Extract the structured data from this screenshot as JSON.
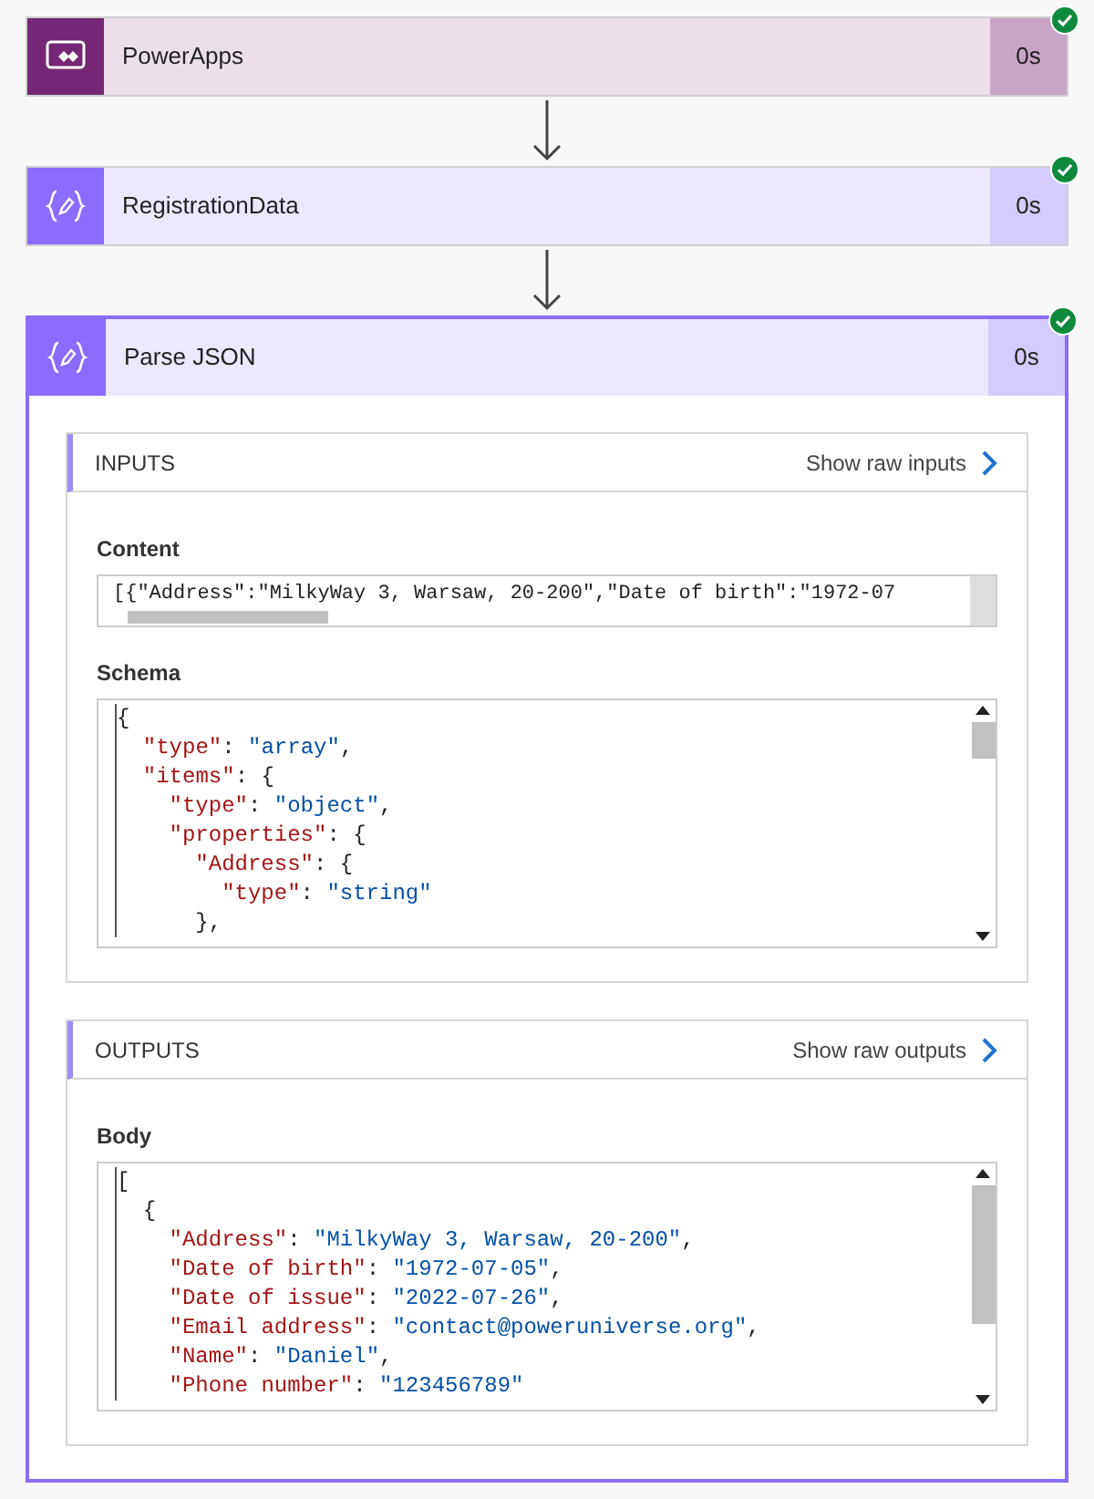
{
  "steps": [
    {
      "kind": "powerapps",
      "title": "PowerApps",
      "duration": "0s",
      "succeeded": true,
      "expanded": false
    },
    {
      "kind": "variable",
      "title": "RegistrationData",
      "duration": "0s",
      "succeeded": true,
      "expanded": false
    },
    {
      "kind": "variable",
      "title": "Parse JSON",
      "duration": "0s",
      "succeeded": true,
      "expanded": true,
      "sections": [
        {
          "title": "INPUTS",
          "link": "Show raw inputs",
          "fields": [
            {
              "kind": "line",
              "label": "Content",
              "value": "[{\"Address\":\"MilkyWay 3, Warsaw, 20-200\",\"Date of birth\":\"1972-07"
            },
            {
              "kind": "code",
              "label": "Schema",
              "lines": [
                {
                  "tokens": [
                    {
                      "kind": "punct",
                      "text": "{"
                    }
                  ],
                  "children": [
                    {
                      "tokens": [
                        {
                          "kind": "key",
                          "text": "\"type\""
                        },
                        {
                          "kind": "punct",
                          "text": ": "
                        },
                        {
                          "kind": "string",
                          "text": "\"array\""
                        },
                        {
                          "kind": "punct",
                          "text": ","
                        }
                      ]
                    },
                    {
                      "tokens": [
                        {
                          "kind": "key",
                          "text": "\"items\""
                        },
                        {
                          "kind": "punct",
                          "text": ": {"
                        }
                      ],
                      "children": [
                        {
                          "tokens": [
                            {
                              "kind": "key",
                              "text": "\"type\""
                            },
                            {
                              "kind": "punct",
                              "text": ": "
                            },
                            {
                              "kind": "string",
                              "text": "\"object\""
                            },
                            {
                              "kind": "punct",
                              "text": ","
                            }
                          ]
                        },
                        {
                          "tokens": [
                            {
                              "kind": "key",
                              "text": "\"properties\""
                            },
                            {
                              "kind": "punct",
                              "text": ": {"
                            }
                          ],
                          "children": [
                            {
                              "tokens": [
                                {
                                  "kind": "key",
                                  "text": "\"Address\""
                                },
                                {
                                  "kind": "punct",
                                  "text": ": {"
                                }
                              ],
                              "children": [
                                {
                                  "tokens": [
                                    {
                                      "kind": "key",
                                      "text": "\"type\""
                                    },
                                    {
                                      "kind": "punct",
                                      "text": ": "
                                    },
                                    {
                                      "kind": "string",
                                      "text": "\"string\""
                                    }
                                  ]
                                }
                              ]
                            },
                            {
                              "tokens": [
                                {
                                  "kind": "punct",
                                  "text": "},"
                                }
                              ]
                            }
                          ]
                        }
                      ]
                    }
                  ]
                }
              ]
            }
          ]
        },
        {
          "title": "OUTPUTS",
          "link": "Show raw outputs",
          "fields": [
            {
              "kind": "code",
              "label": "Body",
              "lines": [
                {
                  "tokens": [
                    {
                      "kind": "punct",
                      "text": "["
                    }
                  ],
                  "children": [
                    {
                      "tokens": [
                        {
                          "kind": "punct",
                          "text": "{"
                        }
                      ],
                      "children": [
                        {
                          "tokens": [
                            {
                              "kind": "key",
                              "text": "\"Address\""
                            },
                            {
                              "kind": "punct",
                              "text": ": "
                            },
                            {
                              "kind": "string",
                              "text": "\"MilkyWay 3, Warsaw, 20-200\""
                            },
                            {
                              "kind": "punct",
                              "text": ","
                            }
                          ]
                        },
                        {
                          "tokens": [
                            {
                              "kind": "key",
                              "text": "\"Date of birth\""
                            },
                            {
                              "kind": "punct",
                              "text": ": "
                            },
                            {
                              "kind": "string",
                              "text": "\"1972-07-05\""
                            },
                            {
                              "kind": "punct",
                              "text": ","
                            }
                          ]
                        },
                        {
                          "tokens": [
                            {
                              "kind": "key",
                              "text": "\"Date of issue\""
                            },
                            {
                              "kind": "punct",
                              "text": ": "
                            },
                            {
                              "kind": "string",
                              "text": "\"2022-07-26\""
                            },
                            {
                              "kind": "punct",
                              "text": ","
                            }
                          ]
                        },
                        {
                          "tokens": [
                            {
                              "kind": "key",
                              "text": "\"Email address\""
                            },
                            {
                              "kind": "punct",
                              "text": ": "
                            },
                            {
                              "kind": "string",
                              "text": "\"contact@poweruniverse.org\""
                            },
                            {
                              "kind": "punct",
                              "text": ","
                            }
                          ]
                        },
                        {
                          "tokens": [
                            {
                              "kind": "key",
                              "text": "\"Name\""
                            },
                            {
                              "kind": "punct",
                              "text": ": "
                            },
                            {
                              "kind": "string",
                              "text": "\"Daniel\""
                            },
                            {
                              "kind": "punct",
                              "text": ","
                            }
                          ]
                        },
                        {
                          "tokens": [
                            {
                              "kind": "key",
                              "text": "\"Phone number\""
                            },
                            {
                              "kind": "punct",
                              "text": ": "
                            },
                            {
                              "kind": "string",
                              "text": "\"123456789\""
                            }
                          ]
                        }
                      ]
                    }
                  ]
                }
              ]
            }
          ]
        }
      ]
    }
  ]
}
